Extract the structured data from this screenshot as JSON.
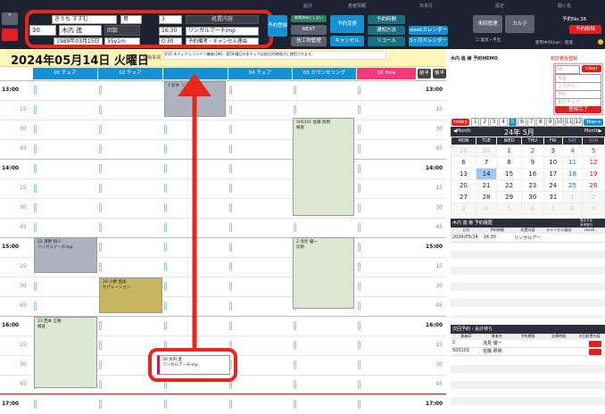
{
  "nav": [
    "設計",
    "患者情報",
    "日本行",
    "設定",
    "開く名"
  ],
  "patient": {
    "kana": "きうち すすむ",
    "gender": "男",
    "id": "30",
    "name": "木内 進",
    "dob": "1989年03月15日",
    "age": "35y1m",
    "count_label": "回数",
    "count": "3",
    "time": "16:30",
    "duration": "0:30",
    "content_label": "処置内容",
    "content_value": "リンガルアーチimp",
    "remarks": "予約備考・キャンセル理由"
  },
  "toolbar": {
    "btn_yoyaku": "予約登録",
    "btn_top_small": "来院済みにしない",
    "btn_next": "NEXT",
    "btn_genba": "技工物管理",
    "btn_change": "予約変更",
    "btn_cancel": "キャンセル",
    "btn_yoyaku_hour": "予約時間",
    "btn_notify": "通知方法",
    "btn_recall": "リコール",
    "btn_week": "weekカレンダー",
    "btn_3month": "3ヶ月カレンダー",
    "btn_raiin": "来院管理",
    "btn_karte": "カルテ",
    "yoyaku_no": "予約No.36",
    "btn_delete": "予約削除",
    "chk_label": "取消・不出",
    "user": "使用中のUser：管理"
  },
  "date_title": "2024年05月14日 火曜日",
  "notice_label": "連絡事項",
  "notice_text": "3/15 木チェア:レントゲン機械(1時)、第5木曜日の木チェアは前日20時過ぎに使用されます。",
  "chairs": [
    {
      "label": "01 チェア",
      "color": "#1590d0"
    },
    {
      "label": "02 チェア",
      "color": "#1590d0"
    },
    {
      "label": "",
      "color": "#1590d0"
    },
    {
      "label": "04 チェア",
      "color": "#1590d0"
    },
    {
      "label": "05 カウンセリング",
      "color": "#1590d0"
    },
    {
      "label": "06 Free",
      "color": "#f03a7a"
    }
  ],
  "btn_am": "前半",
  "btn_pm": "後半",
  "rows": [
    {
      "t": "13:00",
      "hr": true
    },
    {
      "t": "15",
      "hr": false
    },
    {
      "t": "30",
      "hr": false
    },
    {
      "t": "45",
      "hr": false
    },
    {
      "t": "14:00",
      "hr": true
    },
    {
      "t": "15",
      "hr": false
    },
    {
      "t": "30",
      "hr": false
    },
    {
      "t": "45",
      "hr": false
    },
    {
      "t": "15:00",
      "hr": true
    },
    {
      "t": "15",
      "hr": false
    },
    {
      "t": "30",
      "hr": false
    },
    {
      "t": "45",
      "hr": false
    },
    {
      "t": "16:00",
      "hr": true
    },
    {
      "t": "15",
      "hr": false
    },
    {
      "t": "30",
      "hr": false
    },
    {
      "t": "45",
      "hr": false
    },
    {
      "t": "17:00",
      "hr": true
    }
  ],
  "blocks": {
    "b1": "7 鈴木 リンガルア",
    "b2": "500101 佐藤 照明\n検査",
    "b3": "22 清野 和人\nリンガルアーチimp",
    "b4": "2 浅見 優一\n診断",
    "b5": "28 小野 直美\nセパレーション",
    "b6": "23 西本 正樹\n検査",
    "b7": "30 木内 進\nリンガルアーチimp"
  },
  "memo": {
    "title": "木内 進 様 予約MEMO",
    "reg_title": "初診者仮登録",
    "ph_id": "ID",
    "clear": "clear",
    "ph_name": "氏名",
    "ph_kana": "ふりがな",
    "ph_tel": "TEL",
    "ph_chair": "初介チェア",
    "done": "登録完了"
  },
  "calendar": {
    "today": "today",
    "months": [
      "1",
      "2",
      "3",
      "4",
      "5",
      "6",
      "7",
      "8",
      "9",
      "10",
      "11",
      "12"
    ],
    "year": "Year",
    "prev": "Month",
    "next": "Month",
    "title": "24年 5月",
    "dow": [
      "MON",
      "TUE",
      "WED",
      "THU",
      "FRI",
      "SAT",
      "SUN"
    ],
    "weeks": [
      [
        "29",
        "30",
        "1",
        "2",
        "3",
        "4",
        "5"
      ],
      [
        "6",
        "7",
        "8",
        "9",
        "10",
        "11",
        "12"
      ],
      [
        "13",
        "14",
        "15",
        "16",
        "17",
        "18",
        "19"
      ],
      [
        "20",
        "21",
        "22",
        "23",
        "24",
        "25",
        "26"
      ],
      [
        "27",
        "28",
        "29",
        "30",
        "31",
        "1",
        "2"
      ],
      [
        "3",
        "4",
        "5",
        "6",
        "7",
        "8",
        "9"
      ]
    ]
  },
  "history": {
    "title": "木内 進 様 予約履歴",
    "note": "表示する\n未来前日",
    "cols": [
      "日付",
      "予約時間",
      "処置内容",
      "キャンセル理由",
      "recall"
    ],
    "row": [
      "2024/05/14",
      "16:30",
      "リンガルアー",
      "",
      ""
    ]
  },
  "next_list": {
    "title": "次回予約・会計待ち",
    "cols": [
      "患者ID",
      "患者名",
      "予約期限",
      "診療時間",
      "次回処置内容"
    ],
    "rows": [
      [
        "2",
        "浅見 優一"
      ],
      [
        "500101",
        "佐藤 照明"
      ]
    ]
  }
}
